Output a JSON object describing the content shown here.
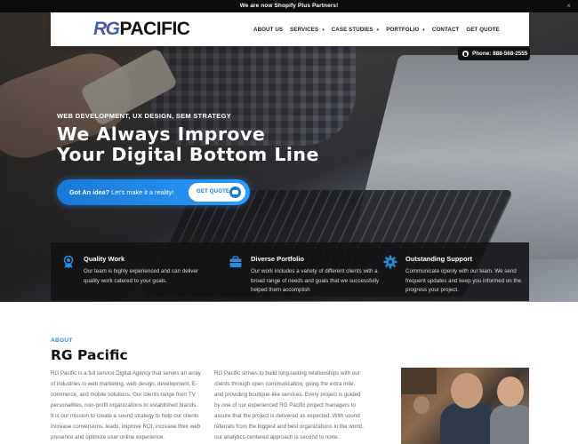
{
  "topbar": {
    "message": "We are now Shopify Plus Partners!",
    "close": "×"
  },
  "brand": {
    "logo_rg": "RG",
    "logo_pacific": "PACIFIC"
  },
  "nav": {
    "items": [
      {
        "label": "ABOUT US",
        "dropdown": false
      },
      {
        "label": "SERVICES",
        "dropdown": true
      },
      {
        "label": "CASE STUDIES",
        "dropdown": true
      },
      {
        "label": "PORTFOLIO",
        "dropdown": true
      },
      {
        "label": "CONTACT",
        "dropdown": false
      },
      {
        "label": "GET QUOTE",
        "dropdown": false
      }
    ],
    "caret": "▾"
  },
  "phone": {
    "label": "Phone: 888-568-2555",
    "icon": "phone-icon"
  },
  "hero": {
    "subhead": "WEB DEVELOPMENT, UX DESIGN, SEM STRATEGY",
    "headline_line1": "We Always Improve",
    "headline_line2": "Your Digital Bottom Line",
    "cta_bold": "Got An idea?",
    "cta_text": " Let's make it a reality!",
    "cta_button": "GET QUOTE",
    "cta_icon": "chat-icon"
  },
  "features": [
    {
      "icon": "award-icon",
      "title": "Quality Work",
      "desc": "Our team is highly experienced and can deliver quality work catered to your goals."
    },
    {
      "icon": "briefcase-icon",
      "title": "Diverse Portfolio",
      "desc": "Our work includes a variety of different clients with a broad range of needs and goals that we successfully helped them accomplish"
    },
    {
      "icon": "gear-icon",
      "title": "Outstanding Support",
      "desc": "Communicate openly with our team. We send frequent updates and keep you informed on the progress your project."
    }
  ],
  "about": {
    "label": "ABOUT",
    "title": "RG Pacific",
    "para1": "RG Pacific is a full service Digital Agency that serves an array of industries in web marketing, web design, development, E-commerce, and mobile solutions. Our clients range from TV personalities, non-profit organizations to established brands. It is our mission to create a sound strategy to help our clients increase conversions, leads, improve ROI, increase their web presence and optimize user online experience.",
    "para2": "RG Pacific strives to build long-lasting relationships with our clients through open communication, going the extra mile, and providing boutique-like services. Every project is guided by one of our experienced RG Pacific project managers to assure that the project is delivered as expected. With sound referrals from the biggest and best organizations in the world, our analytics-centered approach is second to none."
  },
  "colors": {
    "accent": "#2a8bd8",
    "brand_blue": "#4a5aa8",
    "dark": "#111111"
  }
}
